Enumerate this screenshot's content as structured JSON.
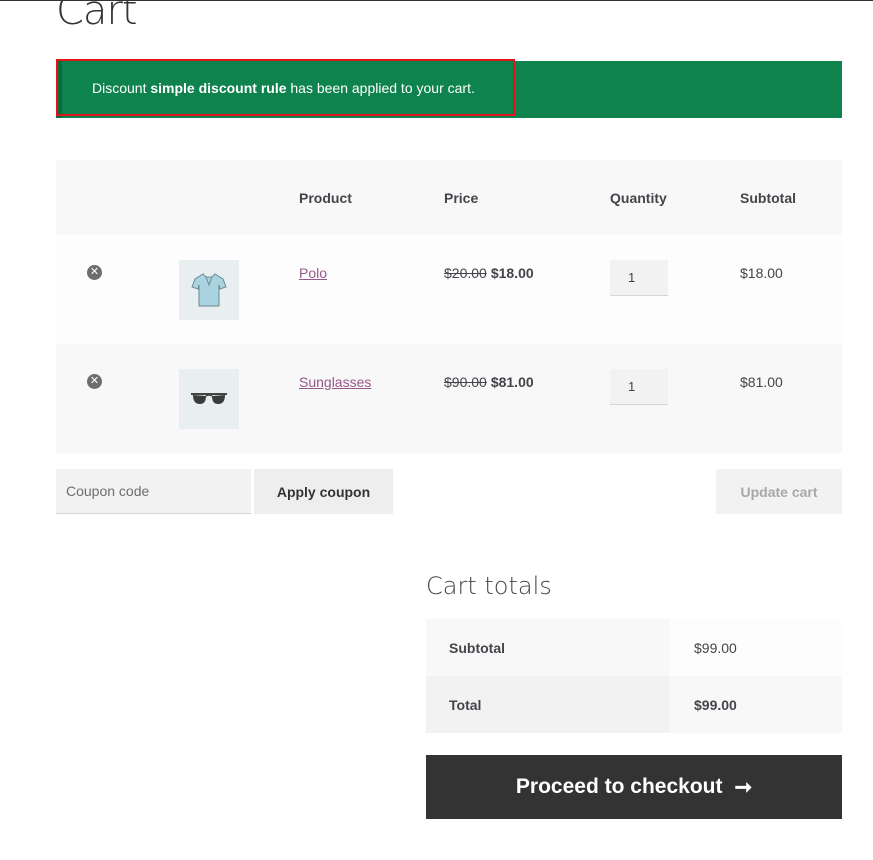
{
  "page": {
    "title": "Cart"
  },
  "notice": {
    "prefix": "Discount ",
    "rule_name": "simple discount rule",
    "suffix": " has been applied to your cart."
  },
  "cart_table": {
    "headers": [
      "",
      "",
      "Product",
      "Price",
      "Quantity",
      "Subtotal"
    ],
    "items": [
      {
        "name": "Polo",
        "old_price": "$20.00",
        "new_price": "$18.00",
        "quantity": "1",
        "subtotal": "$18.00",
        "thumb_icon": "polo-shirt-icon"
      },
      {
        "name": "Sunglasses",
        "old_price": "$90.00",
        "new_price": "$81.00",
        "quantity": "1",
        "subtotal": "$81.00",
        "thumb_icon": "sunglasses-icon"
      }
    ]
  },
  "actions": {
    "coupon_placeholder": "Coupon code",
    "apply_coupon": "Apply coupon",
    "update_cart": "Update cart"
  },
  "totals": {
    "title": "Cart totals",
    "subtotal_label": "Subtotal",
    "subtotal_value": "$99.00",
    "total_label": "Total",
    "total_value": "$99.00"
  },
  "checkout": {
    "label": "Proceed to checkout",
    "arrow": "➞"
  },
  "colors": {
    "notice_bg": "#0f834d",
    "highlight_border": "#e0141a",
    "link": "#96588a",
    "checkout_bg": "#333333"
  }
}
